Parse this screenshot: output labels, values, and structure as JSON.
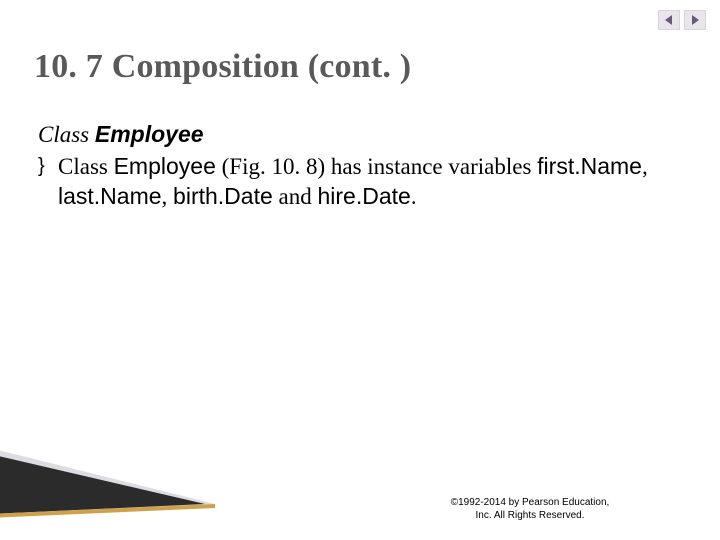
{
  "nav": {
    "prev_name": "prev-slide-button",
    "next_name": "next-slide-button"
  },
  "title": "10. 7 Composition (cont. )",
  "subhead": {
    "prefix": "Class ",
    "employee": "Employee"
  },
  "bullet": {
    "mark": "}",
    "t1": "Class ",
    "code1": "Employee",
    "t2": " (Fig. 10. 8) has instance variables ",
    "code2": "first.Name",
    "t3": ", ",
    "code3": "last.Name",
    "t4": ", ",
    "code4": "birth.Date",
    "t5": " and ",
    "code5": "hire.Date",
    "t6": "."
  },
  "footer": {
    "line1": "©1992-2014 by Pearson Education,",
    "line2": "Inc. All Rights Reserved."
  }
}
